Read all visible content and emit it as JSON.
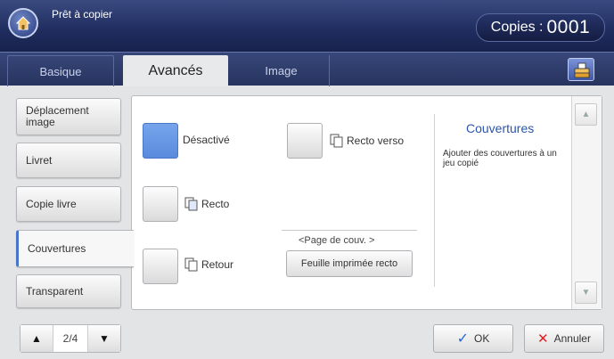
{
  "header": {
    "status": "Prêt à copier",
    "copies_label": "Copies :",
    "copies_value": "0001"
  },
  "tabs": [
    {
      "label": "Basique"
    },
    {
      "label": "Avancés"
    },
    {
      "label": "Image"
    }
  ],
  "sidebar": {
    "items": [
      {
        "label": "Déplacement image"
      },
      {
        "label": "Livret"
      },
      {
        "label": "Copie livre"
      },
      {
        "label": "Couvertures"
      },
      {
        "label": "Transparent"
      }
    ]
  },
  "options": {
    "desactive": "Désactivé",
    "recto_verso": "Recto verso",
    "recto": "Recto",
    "retour": "Retour",
    "page_couv": "<Page de couv. >",
    "feuille": "Feuille imprimée recto"
  },
  "help": {
    "title": "Couvertures",
    "desc": "Ajouter des couvertures à un jeu copié"
  },
  "pager": {
    "page": "2/4"
  },
  "actions": {
    "ok": "OK",
    "cancel": "Annuler"
  },
  "colors": {
    "accent": "#2a55b0",
    "selected": "#6a98e4",
    "header": "#1f2c5e",
    "cancel_icon": "#e02020",
    "ok_icon": "#2a6ad0"
  }
}
